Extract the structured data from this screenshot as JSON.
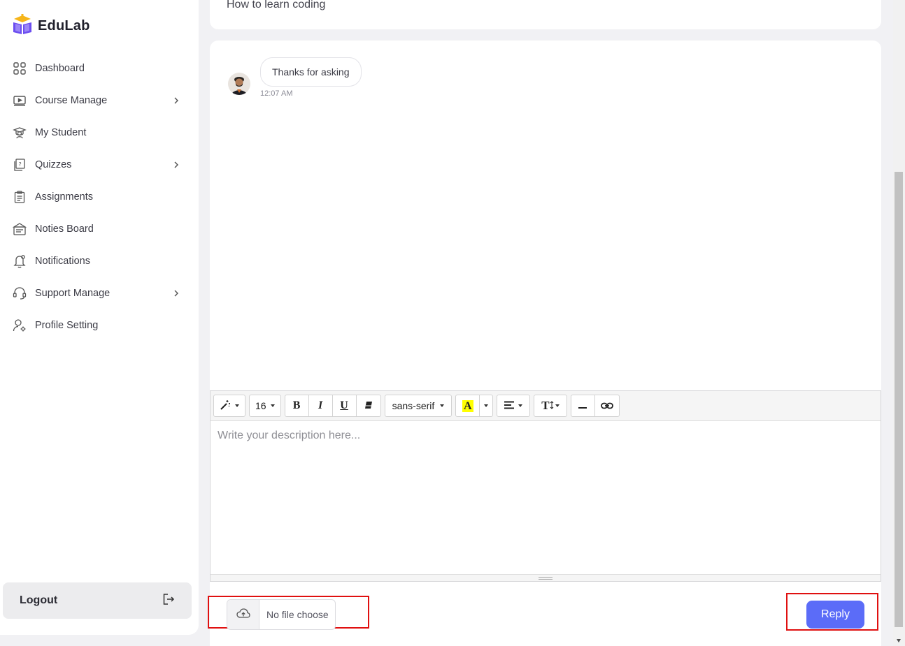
{
  "brand": {
    "name": "EduLab",
    "logo_icon": "graduation-book-logo"
  },
  "sidebar": {
    "items": [
      {
        "label": "Dashboard",
        "icon": "grid-icon",
        "has_submenu": false
      },
      {
        "label": "Course Manage",
        "icon": "video-play-icon",
        "has_submenu": true
      },
      {
        "label": "My Student",
        "icon": "student-icon",
        "has_submenu": false
      },
      {
        "label": "Quizzes",
        "icon": "quiz-icon",
        "has_submenu": true
      },
      {
        "label": "Assignments",
        "icon": "clipboard-icon",
        "has_submenu": false
      },
      {
        "label": "Noties Board",
        "icon": "board-icon",
        "has_submenu": false
      },
      {
        "label": "Notifications",
        "icon": "bell-icon",
        "has_submenu": false
      },
      {
        "label": "Support Manage",
        "icon": "headset-icon",
        "has_submenu": true
      },
      {
        "label": "Profile Setting",
        "icon": "user-gear-icon",
        "has_submenu": false
      }
    ],
    "logout_label": "Logout"
  },
  "topic": {
    "title": "How to learn coding"
  },
  "messages": [
    {
      "text": "Thanks for asking",
      "time": "12:07 AM"
    }
  ],
  "editor": {
    "font_size": "16",
    "font_family": "sans-serif",
    "placeholder": "Write your description here...",
    "toolbar": {
      "bold": "B",
      "italic": "I",
      "underline": "U",
      "text_color": "A",
      "text_size": "T"
    }
  },
  "attachment": {
    "label": "No file choose"
  },
  "reply_label": "Reply",
  "colors": {
    "accent": "#5b6cf8",
    "highlight_box": "#e01010"
  }
}
